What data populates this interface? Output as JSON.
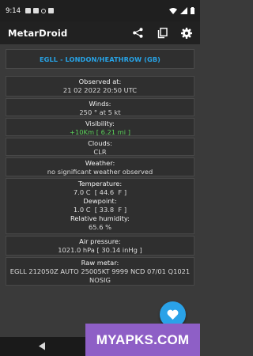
{
  "status_bar": {
    "time": "9:14"
  },
  "app_bar": {
    "title": "MetarDroid",
    "actions": [
      {
        "name": "share-icon"
      },
      {
        "name": "copy-icon"
      },
      {
        "name": "gear-icon"
      }
    ]
  },
  "station": {
    "label": "EGLL - LONDON/HEATHROW (GB)"
  },
  "observed": {
    "label": "Observed at:",
    "value": "21 02 2022 20:50 UTC"
  },
  "winds": {
    "label": "Winds:",
    "value": "250 ° at 5 kt"
  },
  "visibility": {
    "label": "Visibility:",
    "value": "+10Km [ 6.21 mi ]"
  },
  "clouds": {
    "label": "Clouds:",
    "value": "CLR"
  },
  "weather": {
    "label": "Weather:",
    "value": "no significant weather observed"
  },
  "temperature": {
    "label": "Temperature:",
    "value": "7.0 C  [ 44.6  F ]"
  },
  "dewpoint": {
    "label": "Dewpoint:",
    "value": "1.0 C  [ 33.8  F ]"
  },
  "humidity": {
    "label": "Relative humidity:",
    "value": "65.6 %"
  },
  "pressure": {
    "label": "Air pressure:",
    "value": "1021.0 hPa [ 30.14 inHg ]"
  },
  "raw": {
    "label": "Raw metar:",
    "value": "EGLL 212050Z AUTO 25005KT 9999 NCD 07/01 Q1021 NOSIG"
  },
  "fab": {
    "icon": "heart-icon"
  },
  "watermark": {
    "text": "MYAPKS.COM"
  },
  "colors": {
    "accent": "#27a3e6",
    "visibility_value": "#5bd15b",
    "fab": "#2aa2e8",
    "watermark": "#8e5fc6"
  }
}
